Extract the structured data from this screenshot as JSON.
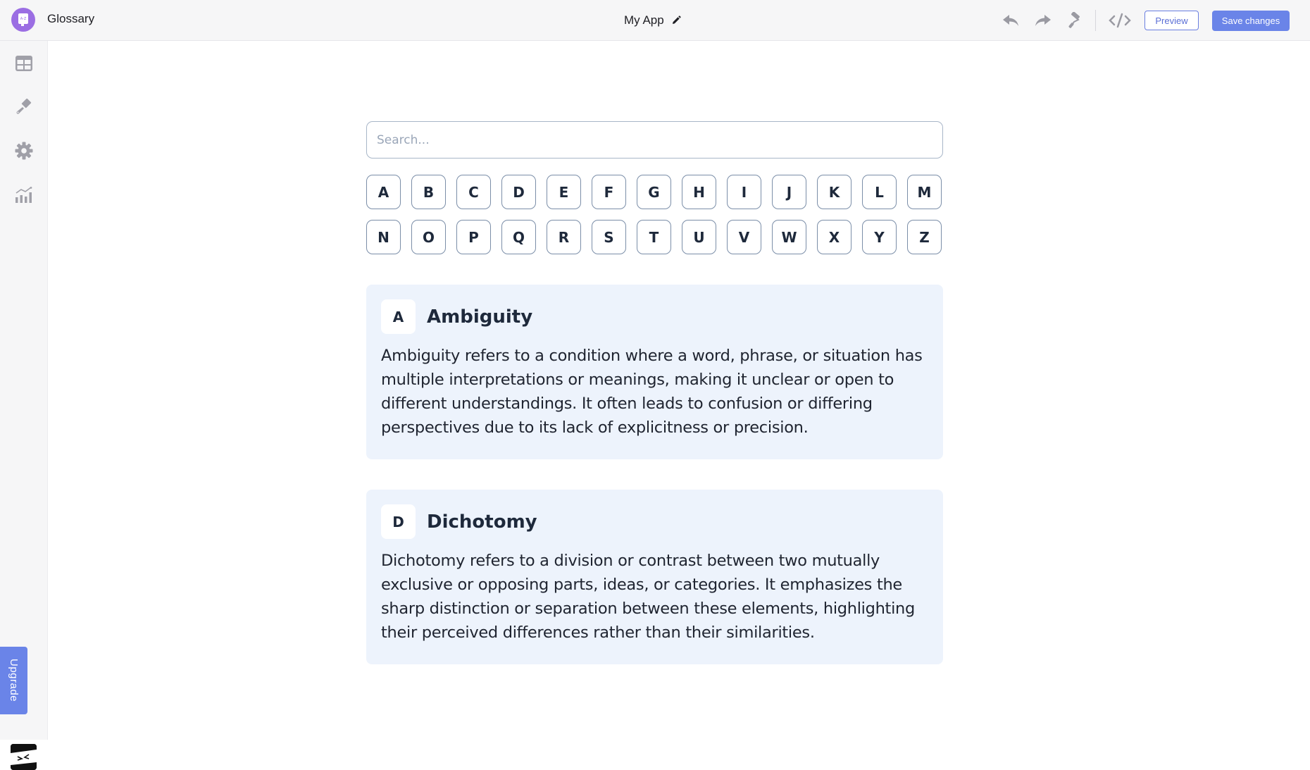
{
  "header": {
    "app_name": "Glossary",
    "title": "My App",
    "toolbar": {
      "undo_icon": "undo-icon",
      "redo_icon": "redo-icon",
      "theme_icon": "paint-roller-icon",
      "code_icon": "code-icon",
      "preview_label": "Preview",
      "save_label": "Save changes"
    }
  },
  "sidebar": {
    "items": [
      {
        "name": "table-icon"
      },
      {
        "name": "brush-icon"
      },
      {
        "name": "gear-icon"
      },
      {
        "name": "analytics-icon"
      }
    ],
    "upgrade_label": "Upgrade"
  },
  "main": {
    "search": {
      "placeholder": "Search...",
      "value": ""
    },
    "letters": [
      "A",
      "B",
      "C",
      "D",
      "E",
      "F",
      "G",
      "H",
      "I",
      "J",
      "K",
      "L",
      "M",
      "N",
      "O",
      "P",
      "Q",
      "R",
      "S",
      "T",
      "U",
      "V",
      "W",
      "X",
      "Y",
      "Z"
    ],
    "entries": [
      {
        "letter": "A",
        "term": "Ambiguity",
        "definition": "Ambiguity refers to a condition where a word, phrase, or situation has multiple interpretations or meanings, making it unclear or open to different understandings. It often leads to confusion or differing perspectives due to its lack of explicitness or precision."
      },
      {
        "letter": "D",
        "term": "Dichotomy",
        "definition": "Dichotomy refers to a division or contrast between two mutually exclusive or opposing parts, ideas, or categories. It emphasizes the sharp distinction or separation between these elements, highlighting their perceived differences rather than their similarities."
      }
    ]
  },
  "colors": {
    "accent": "#6a84e8",
    "logo": "#9b6ee3",
    "card_bg": "#edf3fc",
    "text_dark": "#1e293b"
  }
}
